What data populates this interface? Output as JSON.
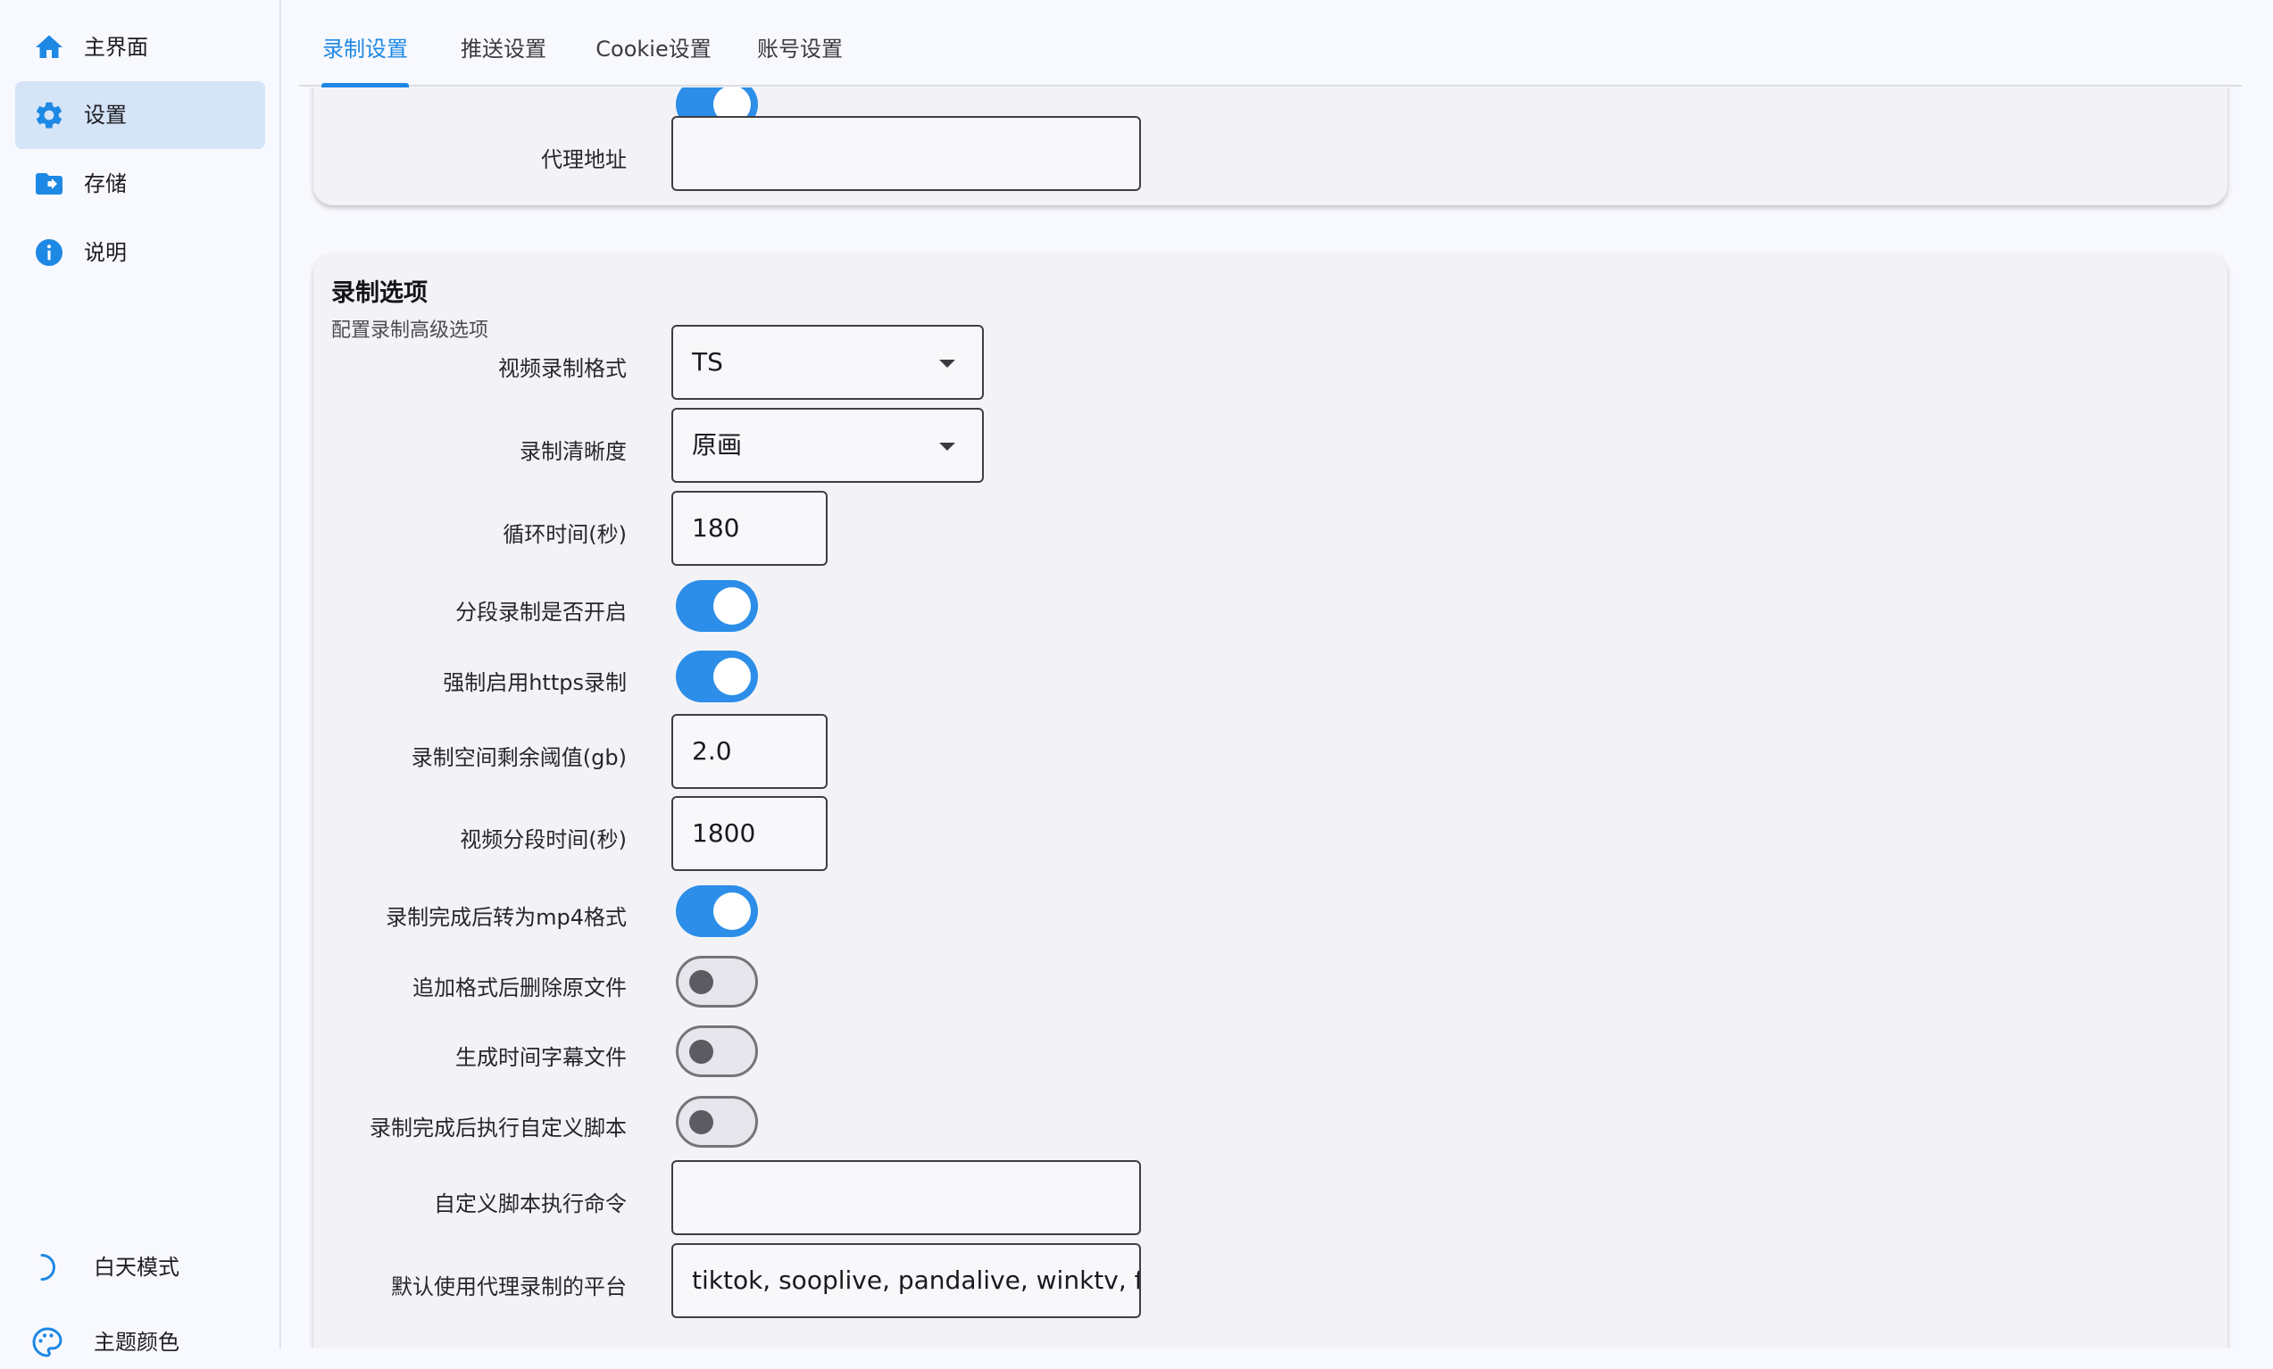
{
  "sidebar": {
    "items": [
      {
        "label": "主界面",
        "icon": "home-icon",
        "active": false
      },
      {
        "label": "设置",
        "icon": "gear-icon",
        "active": true
      },
      {
        "label": "存储",
        "icon": "folder-icon",
        "active": false
      },
      {
        "label": "说明",
        "icon": "info-icon",
        "active": false
      }
    ],
    "bottom": [
      {
        "label": "白天模式",
        "icon": "moon-icon"
      },
      {
        "label": "主题颜色",
        "icon": "palette-icon"
      }
    ]
  },
  "tabs": [
    {
      "label": "录制设置",
      "active": true
    },
    {
      "label": "推送设置",
      "active": false
    },
    {
      "label": "Cookie设置",
      "active": false
    },
    {
      "label": "账号设置",
      "active": false
    }
  ],
  "proxy_card": {
    "proxy_address_label": "代理地址",
    "proxy_address_value": "",
    "partial_toggle_on": true
  },
  "recording_card": {
    "title": "录制选项",
    "subtitle": "配置录制高级选项",
    "video_format": {
      "label": "视频录制格式",
      "value": "TS"
    },
    "quality": {
      "label": "录制清晰度",
      "value": "原画"
    },
    "loop_time": {
      "label": "循环时间(秒)",
      "value": "180"
    },
    "segment_enabled": {
      "label": "分段录制是否开启",
      "on": true
    },
    "force_https": {
      "label": "强制启用https录制",
      "on": true
    },
    "space_threshold": {
      "label": "录制空间剩余阈值(gb)",
      "value": "2.0"
    },
    "segment_time": {
      "label": "视频分段时间(秒)",
      "value": "1800"
    },
    "convert_mp4": {
      "label": "录制完成后转为mp4格式",
      "on": true
    },
    "delete_original": {
      "label": "追加格式后删除原文件",
      "on": false
    },
    "subtitle_file": {
      "label": "生成时间字幕文件",
      "on": false
    },
    "run_script": {
      "label": "录制完成后执行自定义脚本",
      "on": false
    },
    "script_command": {
      "label": "自定义脚本执行命令",
      "value": ""
    },
    "proxy_platforms": {
      "label": "默认使用代理录制的平台",
      "value": "tiktok, sooplive, pandalive, winktv, f"
    }
  },
  "colors": {
    "accent": "#1e88e5",
    "active_nav_bg": "#d5e4f7",
    "toggle_on": "#2c8ee8"
  }
}
